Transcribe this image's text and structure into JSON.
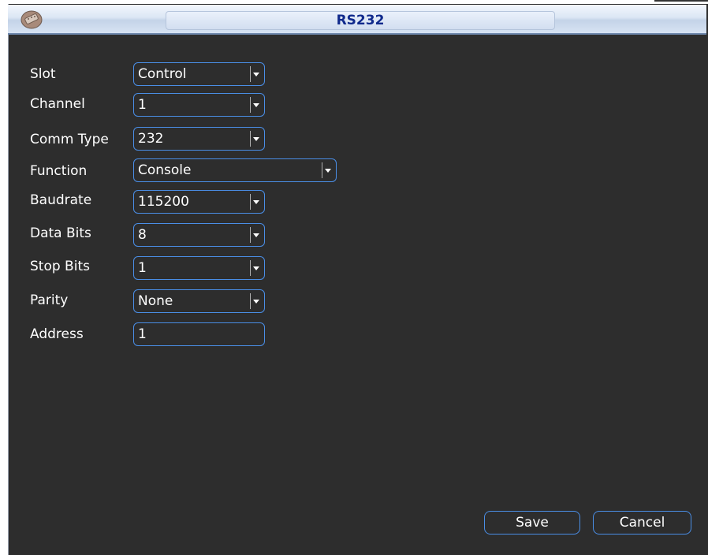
{
  "window": {
    "title": "RS232"
  },
  "form": {
    "slot": {
      "label": "Slot",
      "value": "Control"
    },
    "channel": {
      "label": "Channel",
      "value": "1"
    },
    "comm_type": {
      "label": "Comm Type",
      "value": "232"
    },
    "function": {
      "label": "Function",
      "value": "Console"
    },
    "baudrate": {
      "label": "Baudrate",
      "value": "115200"
    },
    "data_bits": {
      "label": "Data Bits",
      "value": "8"
    },
    "stop_bits": {
      "label": "Stop Bits",
      "value": "1"
    },
    "parity": {
      "label": "Parity",
      "value": "None"
    },
    "address": {
      "label": "Address",
      "value": "1"
    }
  },
  "buttons": {
    "save": "Save",
    "cancel": "Cancel"
  },
  "colors": {
    "background": "#2d2d2d",
    "border_accent": "#4a8ee6",
    "title_text": "#102a8c"
  },
  "icons": {
    "app": "serial-connector-icon",
    "dropdown": "chevron-down-icon"
  }
}
